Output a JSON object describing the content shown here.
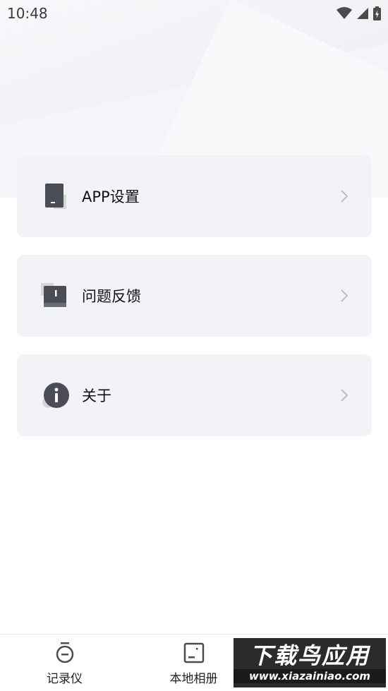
{
  "status_bar": {
    "time": "10:48",
    "icons": [
      "wifi-icon",
      "signal-icon",
      "battery-charging-icon"
    ]
  },
  "menu": {
    "items": [
      {
        "label": "APP设置",
        "icon": "phone-settings-icon"
      },
      {
        "label": "问题反馈",
        "icon": "feedback-book-icon"
      },
      {
        "label": "关于",
        "icon": "info-icon"
      }
    ]
  },
  "tabbar": {
    "tabs": [
      {
        "label": "记录仪",
        "icon": "recorder-icon"
      },
      {
        "label": "本地相册",
        "icon": "album-icon"
      },
      {
        "label": "",
        "icon": "profile-icon"
      }
    ]
  },
  "watermark": {
    "title": "下载鸟应用",
    "url": "www.xiazainiao.com"
  },
  "colors": {
    "card_bg": "#f1f3f7",
    "icon_dark": "#4a4d55",
    "icon_light": "#d4d6da",
    "chevron": "#b5b8be"
  }
}
